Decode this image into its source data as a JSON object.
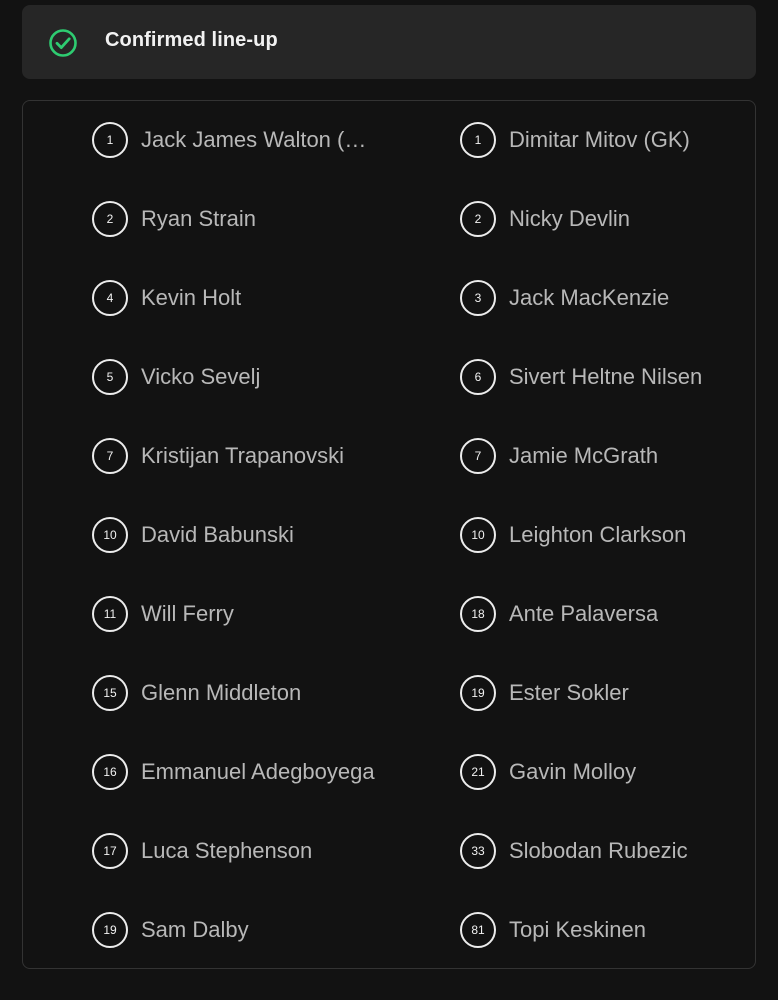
{
  "header": {
    "title": "Confirmed line-up",
    "icon": "check-circle-icon",
    "accent_color": "#2ecc71"
  },
  "home_players": [
    {
      "number": "1",
      "name": "Jack James Walton (GK)"
    },
    {
      "number": "2",
      "name": "Ryan Strain"
    },
    {
      "number": "4",
      "name": "Kevin Holt"
    },
    {
      "number": "5",
      "name": "Vicko Sevelj"
    },
    {
      "number": "7",
      "name": "Kristijan Trapanovski"
    },
    {
      "number": "10",
      "name": "David Babunski"
    },
    {
      "number": "11",
      "name": "Will Ferry"
    },
    {
      "number": "15",
      "name": "Glenn Middleton"
    },
    {
      "number": "16",
      "name": "Emmanuel Adegboyega"
    },
    {
      "number": "17",
      "name": "Luca Stephenson"
    },
    {
      "number": "19",
      "name": "Sam Dalby"
    }
  ],
  "away_players": [
    {
      "number": "1",
      "name": "Dimitar Mitov (GK)"
    },
    {
      "number": "2",
      "name": "Nicky Devlin"
    },
    {
      "number": "3",
      "name": "Jack MacKenzie"
    },
    {
      "number": "6",
      "name": "Sivert Heltne Nilsen"
    },
    {
      "number": "7",
      "name": "Jamie McGrath"
    },
    {
      "number": "10",
      "name": "Leighton Clarkson"
    },
    {
      "number": "18",
      "name": "Ante Palaversa"
    },
    {
      "number": "19",
      "name": "Ester Sokler"
    },
    {
      "number": "21",
      "name": "Gavin Molloy"
    },
    {
      "number": "33",
      "name": "Slobodan Rubezic"
    },
    {
      "number": "81",
      "name": "Topi Keskinen"
    }
  ]
}
